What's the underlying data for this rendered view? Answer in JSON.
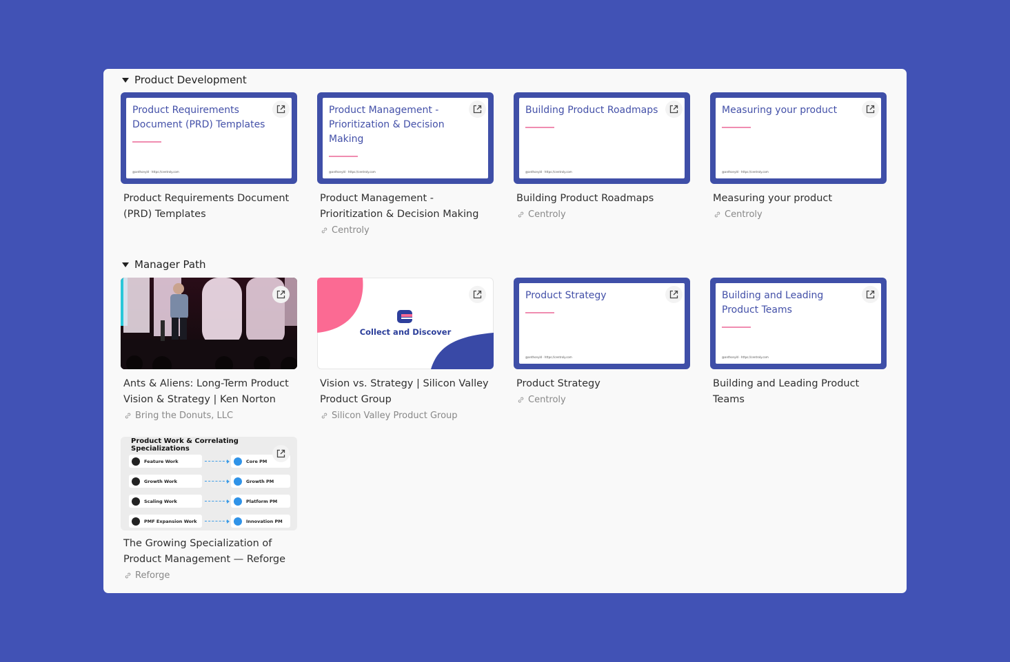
{
  "groups": [
    {
      "label": "Product Development"
    },
    {
      "label": "Manager Path"
    }
  ],
  "cards": [
    {
      "slide_title": "Product Requirements Document (PRD) Templates",
      "slide_footer": "@anthonyld · https://centroly.com",
      "title": "Product Requirements Document (PRD) Templates",
      "source": ""
    },
    {
      "slide_title": "Product Management - Prioritization & Decision Making",
      "slide_footer": "@anthonyld · https://centroly.com",
      "title": "Product Management - Prioritization & Decision Making",
      "source": "Centroly"
    },
    {
      "slide_title": "Building Product Roadmaps",
      "slide_footer": "@anthonyld · https://centroly.com",
      "title": "Building Product Roadmaps",
      "source": "Centroly"
    },
    {
      "slide_title": "Measuring your product",
      "slide_footer": "@anthonyld · https://centroly.com",
      "title": "Measuring your product",
      "source": "Centroly"
    },
    {
      "title": "Ants & Aliens: Long-Term Product Vision & Strategy | Ken Norton",
      "source": "Bring the Donuts, LLC"
    },
    {
      "thumb_text": "Collect and Discover",
      "title": "Vision vs. Strategy | Silicon Valley Product Group",
      "source": "Silicon Valley Product Group"
    },
    {
      "slide_title": "Product Strategy",
      "slide_footer": "@anthonyld · https://centroly.com",
      "title": "Product Strategy",
      "source": "Centroly"
    },
    {
      "slide_title": "Building and Leading Product Teams",
      "slide_footer": "@anthonyld · https://centroly.com",
      "title": "Building and Leading Product Teams",
      "source": ""
    },
    {
      "title": "The Growing Specialization of Product Management — Reforge",
      "source": "Reforge",
      "diagram": {
        "title": "Product Work & Correlating Specializations",
        "rows": [
          {
            "work": "Feature Work",
            "pm": "Core PM"
          },
          {
            "work": "Growth Work",
            "pm": "Growth PM"
          },
          {
            "work": "Scaling Work",
            "pm": "Platform PM"
          },
          {
            "work": "PMF Expansion Work",
            "pm": "Innovation PM"
          }
        ]
      }
    }
  ],
  "icons": {
    "open": "external-link-icon",
    "source": "link-icon",
    "collapse": "caret-down-icon"
  },
  "colors": {
    "background": "#4152b5",
    "slide_border": "#3f4fa8",
    "slide_title": "#4350a8",
    "accent_pink": "#f08cb0"
  }
}
